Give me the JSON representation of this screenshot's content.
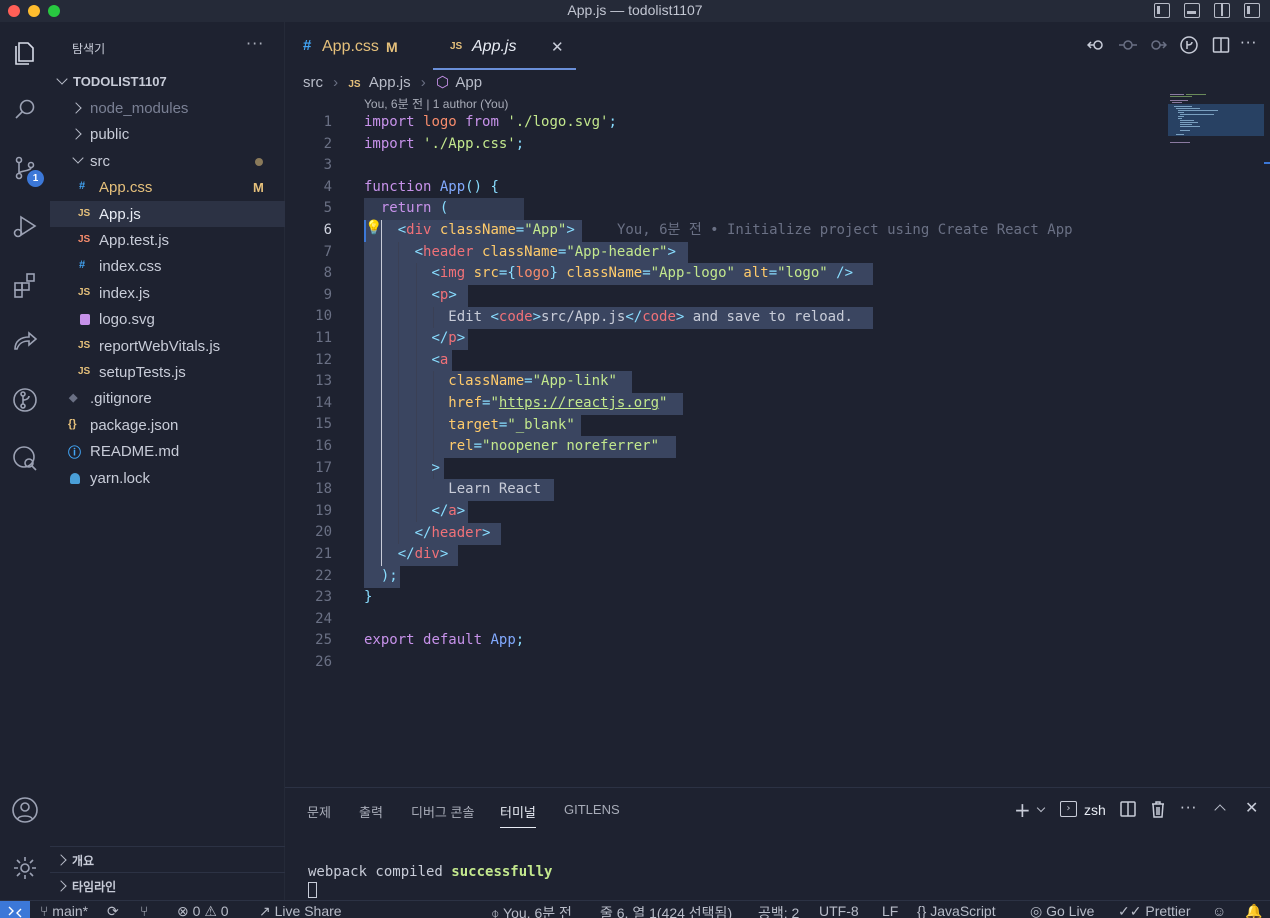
{
  "window": {
    "title": "App.js — todolist1107"
  },
  "activity_bar": {
    "scm_badge": "1"
  },
  "sidebar": {
    "title": "탐색기",
    "more": "···",
    "project": "TODOLIST1107",
    "items": [
      {
        "label": "node_modules",
        "kind": "folder",
        "expanded": false
      },
      {
        "label": "public",
        "kind": "folder",
        "expanded": false
      },
      {
        "label": "src",
        "kind": "folder",
        "expanded": true,
        "status_color": "#8a7a5a"
      },
      {
        "label": "App.css",
        "kind": "css",
        "icon": "#",
        "status": "M",
        "label_color": "#e5c07b"
      },
      {
        "label": "App.js",
        "kind": "js",
        "icon": "JS",
        "active": true
      },
      {
        "label": "App.test.js",
        "kind": "test",
        "icon": "JS"
      },
      {
        "label": "index.css",
        "kind": "css",
        "icon": "#"
      },
      {
        "label": "index.js",
        "kind": "js",
        "icon": "JS"
      },
      {
        "label": "logo.svg",
        "kind": "svg",
        "icon": ""
      },
      {
        "label": "reportWebVitals.js",
        "kind": "js",
        "icon": "JS"
      },
      {
        "label": "setupTests.js",
        "kind": "js",
        "icon": "JS"
      },
      {
        "label": ".gitignore",
        "kind": "git",
        "icon": "◆"
      },
      {
        "label": "package.json",
        "kind": "json",
        "icon": "{}"
      },
      {
        "label": "README.md",
        "kind": "info",
        "icon": "ⓘ"
      },
      {
        "label": "yarn.lock",
        "kind": "lock",
        "icon": ""
      }
    ],
    "outline_label": "개요",
    "timeline_label": "타임라인"
  },
  "tabs": [
    {
      "icon": "#",
      "label": "App.css",
      "status": "M"
    },
    {
      "icon": "JS",
      "label": "App.js",
      "active": true,
      "close": "✕"
    }
  ],
  "breadcrumb": {
    "folder": "src",
    "file": "App.js",
    "symbol": "App"
  },
  "blame": {
    "header": "You, 6분 전 | 1 author (You)",
    "inline": "You, 6분 전 • Initialize project using Create React App"
  },
  "line_numbers": [
    "1",
    "2",
    "3",
    "4",
    "5",
    "6",
    "7",
    "8",
    "9",
    "10",
    "11",
    "12",
    "13",
    "14",
    "15",
    "16",
    "17",
    "18",
    "19",
    "20",
    "21",
    "22",
    "23",
    "24",
    "25",
    "26"
  ],
  "code": {
    "l1": [
      "import",
      "logo",
      "from",
      "'./logo.svg'",
      ";"
    ],
    "l2": [
      "import",
      "'./App.css'",
      ";"
    ],
    "l4": [
      "function",
      "App",
      "()",
      "{"
    ],
    "l5": [
      "return",
      "("
    ],
    "l6": [
      "<",
      "div",
      "className",
      "=",
      "\"App\"",
      ">"
    ],
    "l7": [
      "<",
      "header",
      "className",
      "=",
      "\"App-header\"",
      ">"
    ],
    "l8": [
      "<",
      "img",
      "src",
      "={",
      "logo",
      "}",
      "className",
      "=",
      "\"App-logo\"",
      "alt",
      "=",
      "\"logo\"",
      "/>"
    ],
    "l9": [
      "<",
      "p",
      ">"
    ],
    "l10": [
      "Edit ",
      "<",
      "code",
      ">",
      "src/App.js",
      "</",
      "code",
      ">",
      " and save to reload."
    ],
    "l11": [
      "</",
      "p",
      ">"
    ],
    "l12": [
      "<",
      "a"
    ],
    "l13": [
      "className",
      "=",
      "\"App-link\""
    ],
    "l14": [
      "href",
      "=",
      "\"",
      "https://reactjs.org",
      "\""
    ],
    "l15": [
      "target",
      "=",
      "\"_blank\""
    ],
    "l16": [
      "rel",
      "=",
      "\"noopener noreferrer\""
    ],
    "l17": [
      ">"
    ],
    "l18": [
      "Learn React"
    ],
    "l19": [
      "</",
      "a",
      ">"
    ],
    "l20": [
      "</",
      "header",
      ">"
    ],
    "l21": [
      "</",
      "div",
      ">"
    ],
    "l22": [
      ");"
    ],
    "l23": [
      "}"
    ],
    "l25": [
      "export",
      "default",
      "App",
      ";"
    ]
  },
  "panel": {
    "tabs": [
      "문제",
      "출력",
      "디버그 콘솔",
      "터미널",
      "GITLENS"
    ],
    "active_tab": "터미널",
    "shell": "zsh",
    "terminal_prefix": "webpack compiled ",
    "terminal_success": "successfully"
  },
  "statusbar": {
    "branch": "main*",
    "errors": "0",
    "warnings": "0",
    "live_share": "Live Share",
    "blame": "You, 6분 전",
    "position": "줄 6, 열 1(424 선택됨)",
    "spaces": "공백: 2",
    "encoding": "UTF-8",
    "eol": "LF",
    "language": "JavaScript",
    "go_live": "Go Live",
    "prettier": "Prettier"
  }
}
